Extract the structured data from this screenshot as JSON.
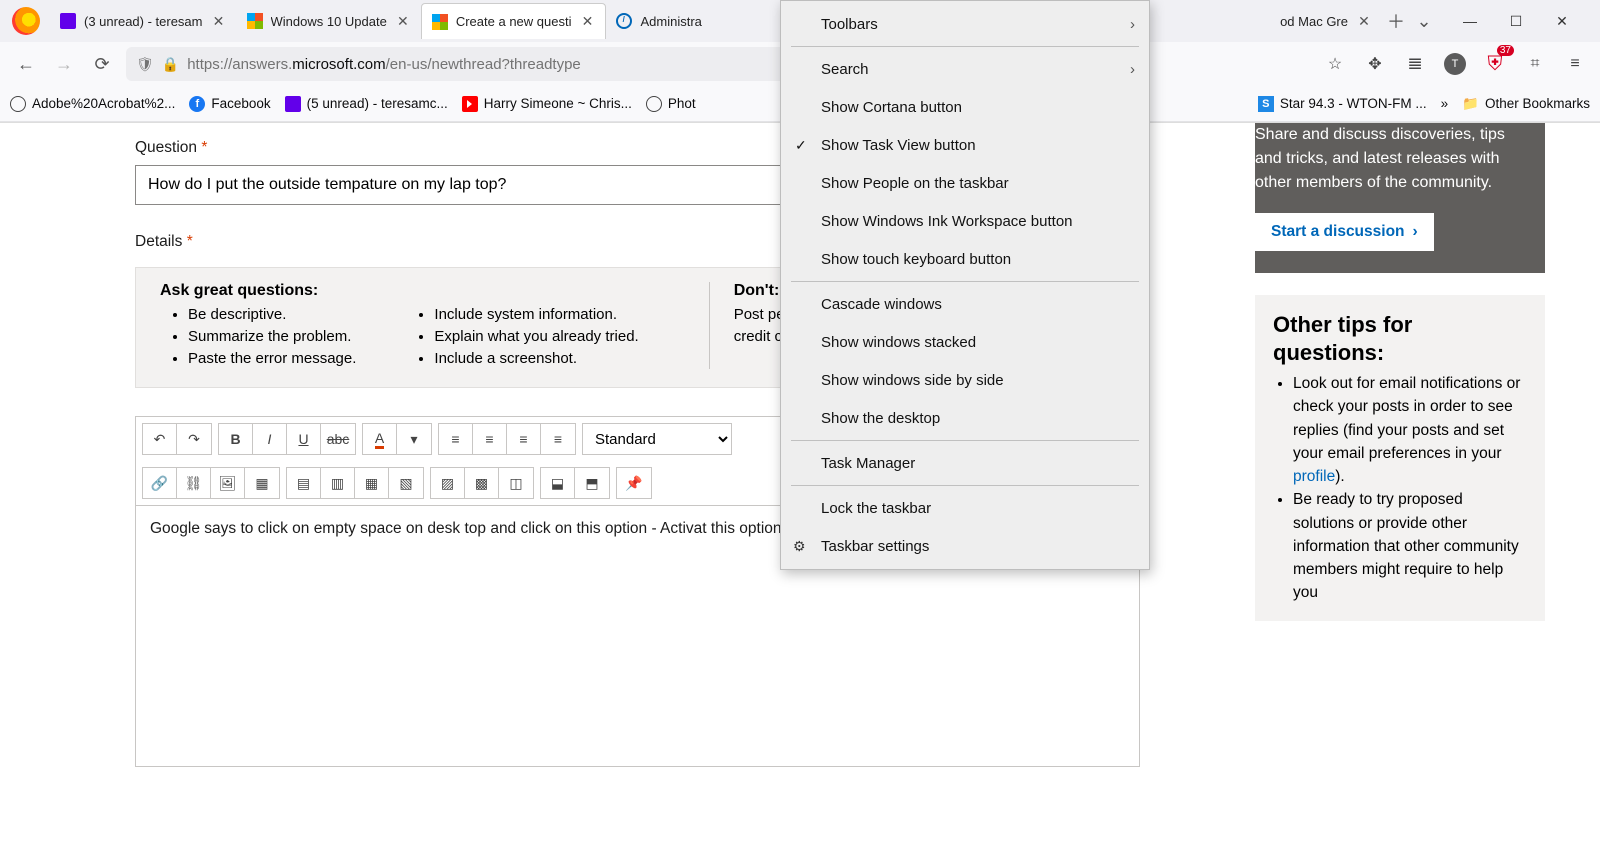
{
  "browser": {
    "tabs": [
      {
        "label": "(3 unread) - teresam",
        "fav": "mail"
      },
      {
        "label": "Windows 10 Update",
        "fav": "fourcolor"
      },
      {
        "label": "Create a new questi",
        "fav": "fourcolor",
        "active": true
      },
      {
        "label": "Administra",
        "fav": "info"
      },
      {
        "label": "od Mac Gre",
        "fav": ""
      }
    ],
    "url_pre": "https://answers.",
    "url_strong": "microsoft.com",
    "url_post": "/en-us/newthread?threadtype",
    "bookmarks": [
      {
        "label": "Adobe%20Acrobat%2...",
        "icon": "globe"
      },
      {
        "label": "Facebook",
        "icon": "fb"
      },
      {
        "label": "(5 unread) - teresamc...",
        "icon": "mail"
      },
      {
        "label": "Harry Simeone ~ Chris...",
        "icon": "yt"
      },
      {
        "label": "Phot",
        "icon": "globe"
      },
      {
        "label": "Star 94.3 - WTON-FM ...",
        "icon": "blueS"
      }
    ],
    "other_bookmarks": "Other Bookmarks",
    "badge_count": "37",
    "avatar_letter": "T"
  },
  "form": {
    "question_label": "Question",
    "question_value": "How do I put the outside tempature on my lap top?",
    "details_label": "Details",
    "hints": {
      "ask_title": "Ask great questions:",
      "ask_items_a": [
        "Be descriptive.",
        "Summarize the problem.",
        "Paste the error message."
      ],
      "ask_items_b": [
        "Include system information.",
        "Explain what you already tried.",
        "Include a screenshot."
      ],
      "dont_title": "Don't:",
      "dont_text": "Post personal informa address, phone numb credit card number, o compromise your priv"
    },
    "style_select": "Standard",
    "editor_text": "Google says to click on empty space on desk top and click on this option - Activat                                      this option at?"
  },
  "side": {
    "promo_text": "Share and discuss discoveries, tips and tricks, and latest releases with other members of the community.",
    "promo_cta": "Start a discussion",
    "tips_title": "Other tips for questions:",
    "tips_item1_a": "Look out for email notifications or check your posts in order to see replies (find your posts and set your email preferences in your ",
    "tips_item1_link": "profile",
    "tips_item1_b": ").",
    "tips_item2": "Be ready to try proposed solutions or provide other information that other community members might require to help you"
  },
  "ctx": {
    "toolbars": "Toolbars",
    "search": "Search",
    "show_cortana": "Show Cortana button",
    "show_taskview": "Show Task View button",
    "show_people": "Show People on the taskbar",
    "show_ink": "Show Windows Ink Workspace button",
    "show_touch": "Show touch keyboard button",
    "cascade": "Cascade windows",
    "stacked": "Show windows stacked",
    "sidebyside": "Show windows side by side",
    "desktop": "Show the desktop",
    "taskmgr": "Task Manager",
    "lock": "Lock the taskbar",
    "settings": "Taskbar settings"
  }
}
